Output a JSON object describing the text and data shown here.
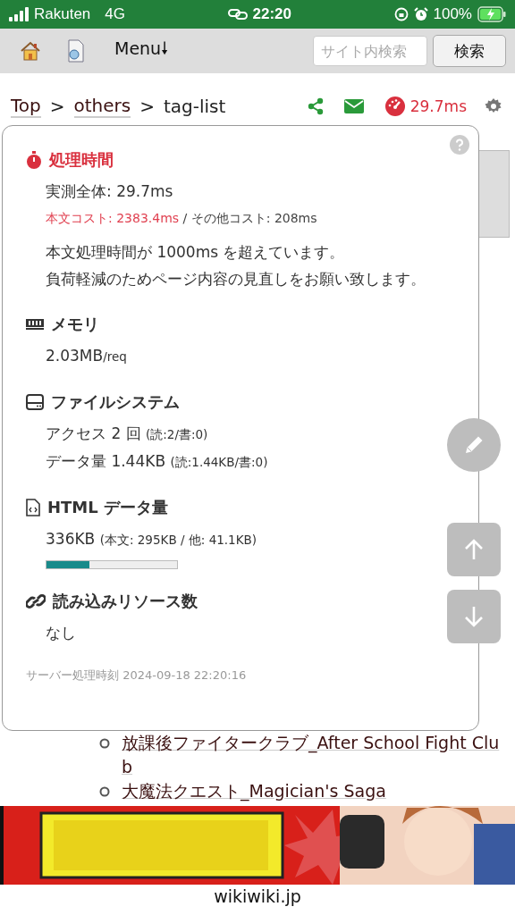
{
  "status_bar": {
    "carrier": "Rakuten",
    "network": "4G",
    "time": "22:20",
    "battery": "100%"
  },
  "toolbar": {
    "menu": "Menu🠗",
    "search": {
      "placeholder": "サイト内検索"
    },
    "search_button": "検索"
  },
  "breadcrumb": [
    {
      "label": "Top",
      "kind": "link"
    },
    {
      "label": ">",
      "kind": "separator"
    },
    {
      "label": "others",
      "kind": "link"
    },
    {
      "label": ">",
      "kind": "separator"
    },
    {
      "label": "tag-list",
      "kind": "current"
    }
  ],
  "timing_badge": "29.7ms",
  "popup": {
    "sections": [
      {
        "kind": "timing",
        "title": "処理時間",
        "lines": [
          {
            "kind": "main",
            "text": "実測全体: 29.7ms"
          },
          {
            "kind": "cost",
            "warn": "本文コスト: 2383.4ms",
            "rest": " / その他コスト: 208ms"
          },
          {
            "kind": "note",
            "text": "本文処理時間が 1000ms を超えています。"
          },
          {
            "kind": "note2",
            "text": "負荷軽減のためページ内容の見直しをお願い致します。"
          }
        ]
      },
      {
        "kind": "memory",
        "title": "メモリ",
        "lines": [
          {
            "kind": "value",
            "text": "2.03MB",
            "small": "/req"
          }
        ]
      },
      {
        "kind": "file",
        "title": "ファイルシステム",
        "lines": [
          {
            "kind": "value",
            "text": "アクセス 2 回 ",
            "small": "(読:2/書:0)"
          },
          {
            "kind": "value",
            "text": "データ量 1.44KB ",
            "small": "(読:1.44KB/書:0)"
          }
        ]
      },
      {
        "kind": "html",
        "title": "HTML データ量",
        "lines": [
          {
            "kind": "value",
            "text": "336KB ",
            "small": "(本文: 295KB / 他: 41.1KB)"
          },
          {
            "kind": "bar",
            "level": 0.33
          }
        ]
      },
      {
        "kind": "link",
        "title": "読み込みリソース数",
        "lines": [
          {
            "kind": "value",
            "text": "なし"
          }
        ]
      }
    ],
    "footer": "サーバー処理時刻 2024-09-18 22:20:16"
  },
  "list": [
    "放課後ファイタークラブ_After School Fight Club",
    "大魔法クエスト_Magician's Saga"
  ],
  "domain": "wikiwiki.jp"
}
